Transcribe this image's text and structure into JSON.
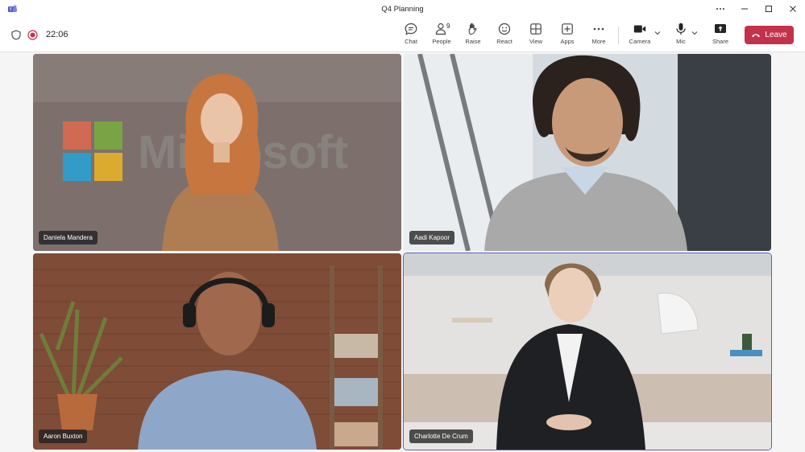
{
  "window": {
    "title": "Q4 Planning",
    "controls": [
      "more",
      "minimize",
      "maximize",
      "close"
    ]
  },
  "meeting": {
    "timer": "22:06",
    "recording": true
  },
  "toolbar": {
    "buttons": [
      {
        "id": "chat",
        "label": "Chat",
        "icon": "chat-icon"
      },
      {
        "id": "people",
        "label": "People",
        "icon": "people-icon",
        "count": "9"
      },
      {
        "id": "raise",
        "label": "Raise",
        "icon": "raise-hand-icon"
      },
      {
        "id": "react",
        "label": "React",
        "icon": "smile-icon"
      },
      {
        "id": "view",
        "label": "View",
        "icon": "view-grid-icon"
      },
      {
        "id": "apps",
        "label": "Apps",
        "icon": "apps-add-icon"
      },
      {
        "id": "more",
        "label": "More",
        "icon": "more-dots-icon"
      },
      {
        "id": "camera",
        "label": "Camera",
        "icon": "camera-icon"
      },
      {
        "id": "mic",
        "label": "Mic",
        "icon": "mic-icon"
      },
      {
        "id": "share",
        "label": "Share",
        "icon": "share-icon"
      }
    ],
    "leave_label": "Leave"
  },
  "participants": [
    {
      "name": "Daniela Mandera",
      "active": false
    },
    {
      "name": "Aadi Kapoor",
      "active": false
    },
    {
      "name": "Aaron Buxton",
      "active": false
    },
    {
      "name": "Charlotte De Crum",
      "active": true
    }
  ],
  "colors": {
    "leave": "#c4314b",
    "active_outline": "#5b5fc7",
    "recording": "#c4314b"
  }
}
